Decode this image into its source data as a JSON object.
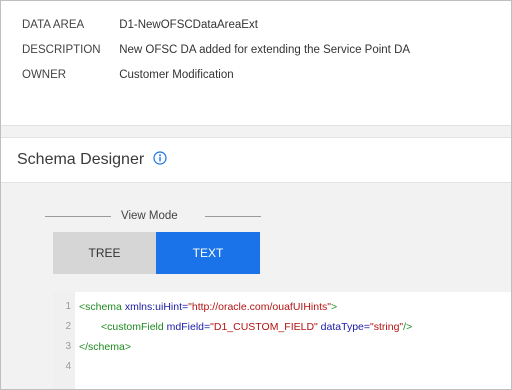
{
  "info": {
    "rows": [
      {
        "label": "DATA AREA",
        "value": "D1-NewOFSCDataAreaExt"
      },
      {
        "label": "DESCRIPTION",
        "value": "New OFSC DA added for extending the Service Point DA"
      },
      {
        "label": "OWNER",
        "value": "Customer Modification"
      }
    ]
  },
  "schema_designer": {
    "title": "Schema Designer",
    "info_icon": "info-circle-icon"
  },
  "view_mode": {
    "legend": "View Mode",
    "tree_label": "TREE",
    "text_label": "TEXT",
    "selected": "TEXT"
  },
  "editor": {
    "lines": [
      {
        "number": "1",
        "parts": [
          "<schema",
          " xmlns:uiHint=",
          "\"http://oracle.com/ouafUIHints\"",
          ">"
        ]
      },
      {
        "number": "2",
        "parts": [
          "<customField",
          " mdField=",
          "\"D1_CUSTOM_FIELD\"",
          " dataType=",
          "\"string\"",
          "/>"
        ]
      },
      {
        "number": "3",
        "parts": [
          "</schema>"
        ]
      },
      {
        "number": "4",
        "parts": []
      }
    ]
  },
  "colors": {
    "accent": "#1a73e8",
    "tree_button_bg": "#d6d6d6",
    "panel_bg": "#f2f2f2",
    "xml_tag": "#1e8a1e",
    "xml_attr": "#1a1aa6",
    "xml_value": "#b31212"
  }
}
